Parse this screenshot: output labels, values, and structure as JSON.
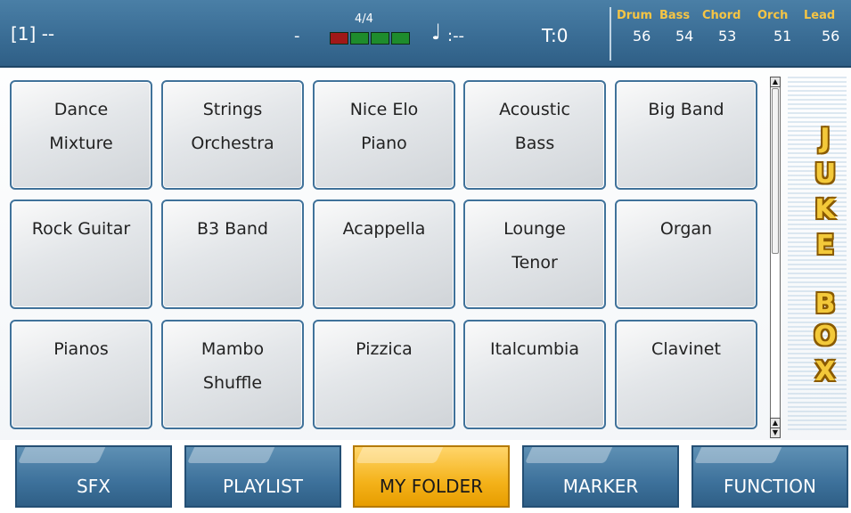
{
  "status": {
    "song_number": "[1] --",
    "dash": "-",
    "time_signature": "4/4",
    "meter": [
      "red",
      "green",
      "green",
      "green"
    ],
    "note_symbol": "♩",
    "tempo": ":--",
    "transpose": "T:0"
  },
  "mixer": [
    {
      "name": "Drum",
      "value": "56"
    },
    {
      "name": "Bass",
      "value": "54"
    },
    {
      "name": "Chord",
      "value": "53"
    },
    {
      "name": "Orch",
      "value": "51"
    },
    {
      "name": "Lead",
      "value": "56"
    }
  ],
  "pads": [
    {
      "line1": "Dance",
      "line2": "Mixture"
    },
    {
      "line1": "Strings",
      "line2": "Orchestra"
    },
    {
      "line1": "Nice Elo",
      "line2": "Piano"
    },
    {
      "line1": "Acoustic",
      "line2": "Bass"
    },
    {
      "line1": "Big Band",
      "line2": ""
    },
    {
      "line1": "Rock Guitar",
      "line2": ""
    },
    {
      "line1": "B3 Band",
      "line2": ""
    },
    {
      "line1": "Acappella",
      "line2": ""
    },
    {
      "line1": "Lounge",
      "line2": "Tenor"
    },
    {
      "line1": "Organ",
      "line2": ""
    },
    {
      "line1": "Pianos",
      "line2": ""
    },
    {
      "line1": "Mambo",
      "line2": "Shuffle"
    },
    {
      "line1": "Pizzica",
      "line2": ""
    },
    {
      "line1": "Italcumbia",
      "line2": ""
    },
    {
      "line1": "Clavinet",
      "line2": ""
    }
  ],
  "jukebox": [
    "J",
    "U",
    "K",
    "E",
    "B",
    "O",
    "X"
  ],
  "tabs": [
    {
      "label": "SFX",
      "active": false
    },
    {
      "label": "PLAYLIST",
      "active": false
    },
    {
      "label": "MY FOLDER",
      "active": true
    },
    {
      "label": "MARKER",
      "active": false
    },
    {
      "label": "FUNCTION",
      "active": false
    }
  ],
  "colors": {
    "bar_blue": "#3a6d95",
    "accent_yellow": "#f4b21a",
    "mixer_label": "#f6c544",
    "meter_red": "#a01818",
    "meter_green": "#1e8c2c"
  }
}
